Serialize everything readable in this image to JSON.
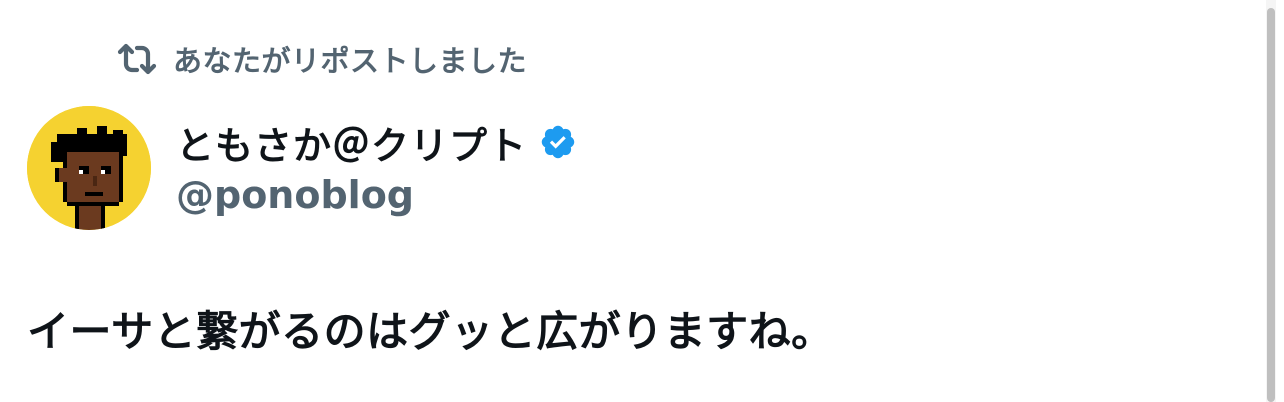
{
  "repost": {
    "icon": "repost-icon",
    "label": "あなたがリポストしました"
  },
  "author": {
    "avatar_icon": "pixel-avatar",
    "display_name": "ともさか＠クリプト",
    "verified_icon": "verified-badge-icon",
    "verified_color": "#1d9bf0",
    "handle": "@ponoblog"
  },
  "tweet": {
    "text": "イーサと繋がるのはグッと広がりますね。"
  },
  "colors": {
    "secondary_text": "#536471",
    "primary_text": "#0f1419",
    "avatar_background": "#f5d230"
  }
}
